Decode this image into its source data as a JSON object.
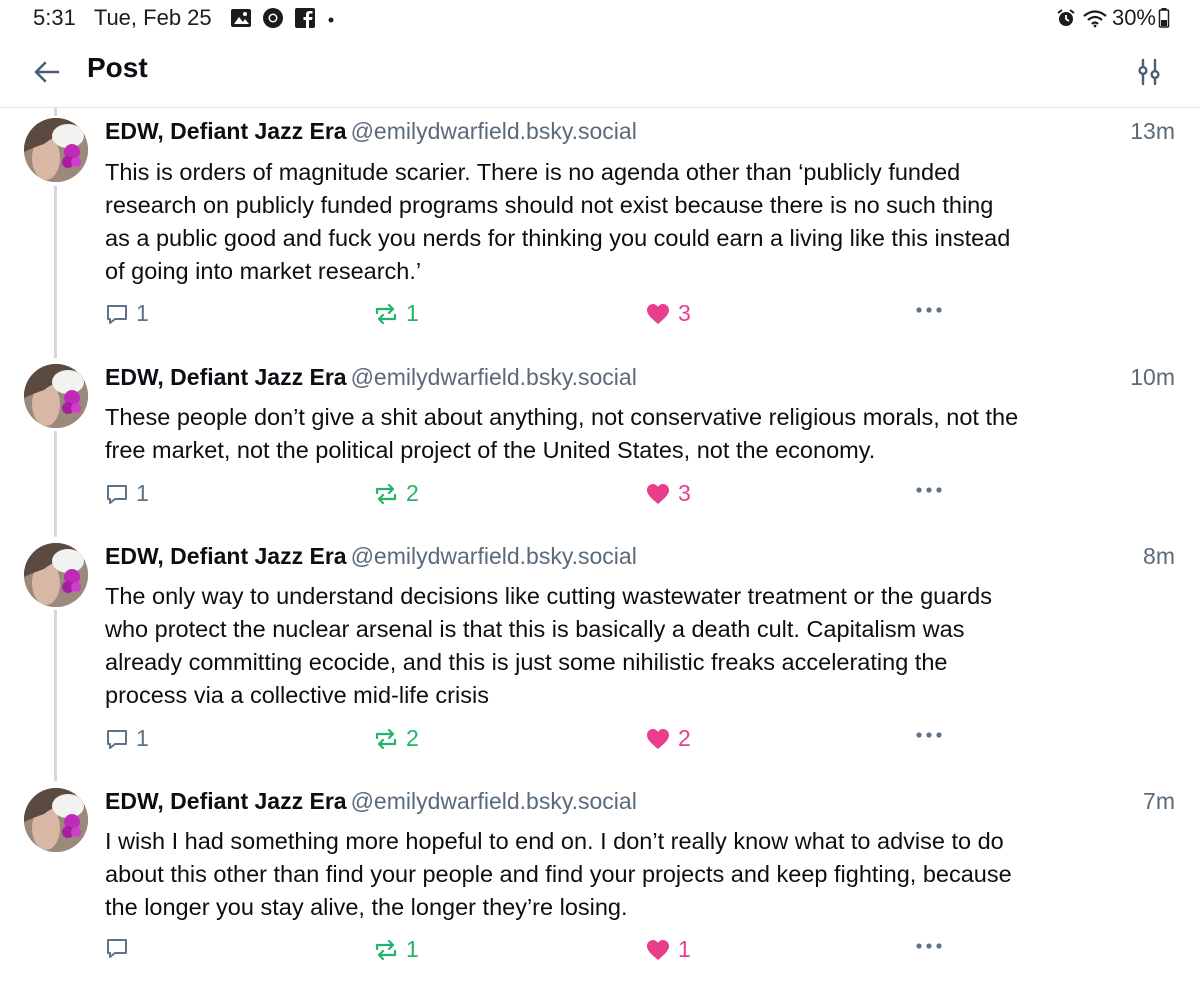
{
  "status_bar": {
    "time": "5:31",
    "date": "Tue, Feb 25",
    "notification_icons": [
      "image-icon",
      "chrome-icon",
      "facebook-icon",
      "dot-icon"
    ],
    "battery": "30%",
    "system_icons": [
      "alarm-icon",
      "wifi-icon",
      "battery-icon"
    ]
  },
  "header": {
    "title": "Post",
    "back_icon": "arrow-left-icon",
    "settings_icon": "sliders-icon"
  },
  "colors": {
    "repost": "#21b46a",
    "like": "#e83e8c",
    "muted": "#5a6a7a",
    "thread_line": "#d4d9de"
  },
  "posts": [
    {
      "author": "EDW, Defiant Jazz Era",
      "handle": "@emilydwarfield.bsky.social",
      "time": "13m",
      "lines": [
        "This is orders of magnitude scarier. There is no agenda other than ‘publicly funded",
        "research on publicly funded programs should not exist because there is no such thing",
        "as a public good and fuck you nerds for thinking you could earn a living like this instead",
        "of going into market research.’"
      ],
      "replies": "1",
      "reposts": "1",
      "likes": "3"
    },
    {
      "author": "EDW, Defiant Jazz Era",
      "handle": "@emilydwarfield.bsky.social",
      "time": "10m",
      "lines": [
        "These people don’t give a shit about anything, not conservative religious morals, not the",
        "free market, not the political project of the United States, not the economy."
      ],
      "replies": "1",
      "reposts": "2",
      "likes": "3"
    },
    {
      "author": "EDW, Defiant Jazz Era",
      "handle": "@emilydwarfield.bsky.social",
      "time": "8m",
      "lines": [
        "The only way to understand decisions like cutting wastewater treatment or the guards",
        "who protect the nuclear arsenal is that this is basically a death cult. Capitalism was",
        "already committing ecocide, and this is just some nihilistic freaks accelerating the",
        "process via a collective mid-life crisis"
      ],
      "replies": "1",
      "reposts": "2",
      "likes": "2"
    },
    {
      "author": "EDW, Defiant Jazz Era",
      "handle": "@emilydwarfield.bsky.social",
      "time": "7m",
      "lines": [
        "I wish I had something more hopeful to end on. I don’t really know what to advise to do",
        "about this other than find your people and find your projects and keep fighting, because",
        "the longer you stay alive, the longer they’re losing."
      ],
      "replies": "",
      "reposts": "1",
      "likes": "1"
    }
  ]
}
